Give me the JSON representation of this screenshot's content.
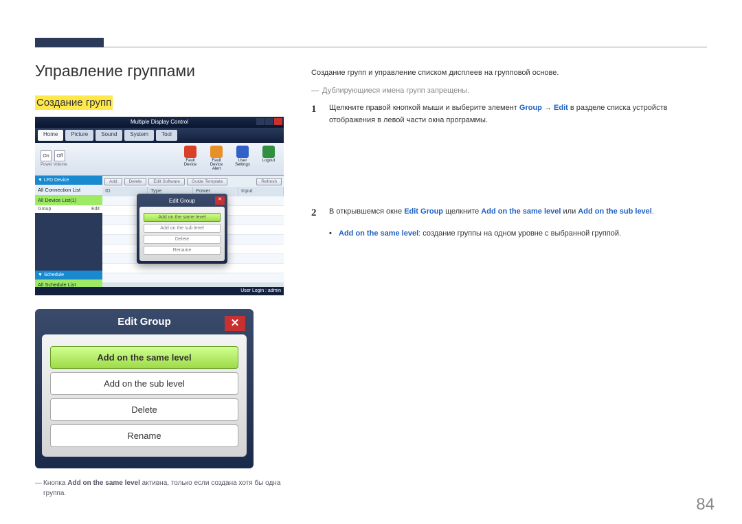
{
  "page_number": "84",
  "h1": "Управление группами",
  "h2": "Создание групп",
  "screenshot1": {
    "window_title": "Multiple Display Control",
    "tabs": [
      "Home",
      "Picture",
      "Sound",
      "System",
      "Tool"
    ],
    "ribbon_left": {
      "on": "On",
      "off": "Off",
      "caption": "Power Volume"
    },
    "ribbon_icons": [
      {
        "label": "Fault Device",
        "color": "#d84028"
      },
      {
        "label": "Fault Device Alert",
        "color": "#e89028"
      },
      {
        "label": "User Settings",
        "color": "#3060c8"
      },
      {
        "label": "Logout",
        "color": "#309040"
      }
    ],
    "subtoolbar": [
      "Add",
      "Delete",
      "Edit Software",
      "Guide Template",
      "Refresh"
    ],
    "sidebar": {
      "sec1": "▼ LFD Device",
      "item1": "All Connection List",
      "item2": "All Device List(1)",
      "row_l": "Group",
      "row_r": "Edit",
      "sec2": "▼ Schedule",
      "item3": "All Schedule List"
    },
    "table_headers": [
      "ID",
      "Type",
      "Power",
      "Input"
    ],
    "popup": {
      "title": "Edit Group",
      "buttons": [
        "Add on the same level",
        "Add on the sub level",
        "Delete",
        "Rename"
      ]
    },
    "status": "User Login : admin"
  },
  "screenshot2": {
    "title": "Edit Group",
    "close": "✕",
    "buttons": [
      "Add on the same level",
      "Add on the sub level",
      "Delete",
      "Rename"
    ]
  },
  "footnote": {
    "pre": "Кнопка ",
    "b": "Add on the same level",
    "post": " активна, только если создана хотя бы одна группа."
  },
  "intro": "Создание групп и управление списком дисплеев на групповой основе.",
  "note": "Дублирующиеся имена групп запрещены.",
  "step1": {
    "pre": "Щелкните правой кнопкой мыши и выберите элемент ",
    "g": "Group",
    "arrow": " → ",
    "e": "Edit",
    "post": " в разделе списка устройств отображения в левой части окна программы."
  },
  "step2": {
    "pre": "В открывшемся окне ",
    "b1": "Edit Group",
    "mid": " щелкните ",
    "b2": "Add on the same level",
    "or": " или ",
    "b3": "Add on the sub level",
    "end": "."
  },
  "bullet1": {
    "b": "Add on the same level",
    "t": ": создание группы на одном уровне с выбранной группой."
  }
}
